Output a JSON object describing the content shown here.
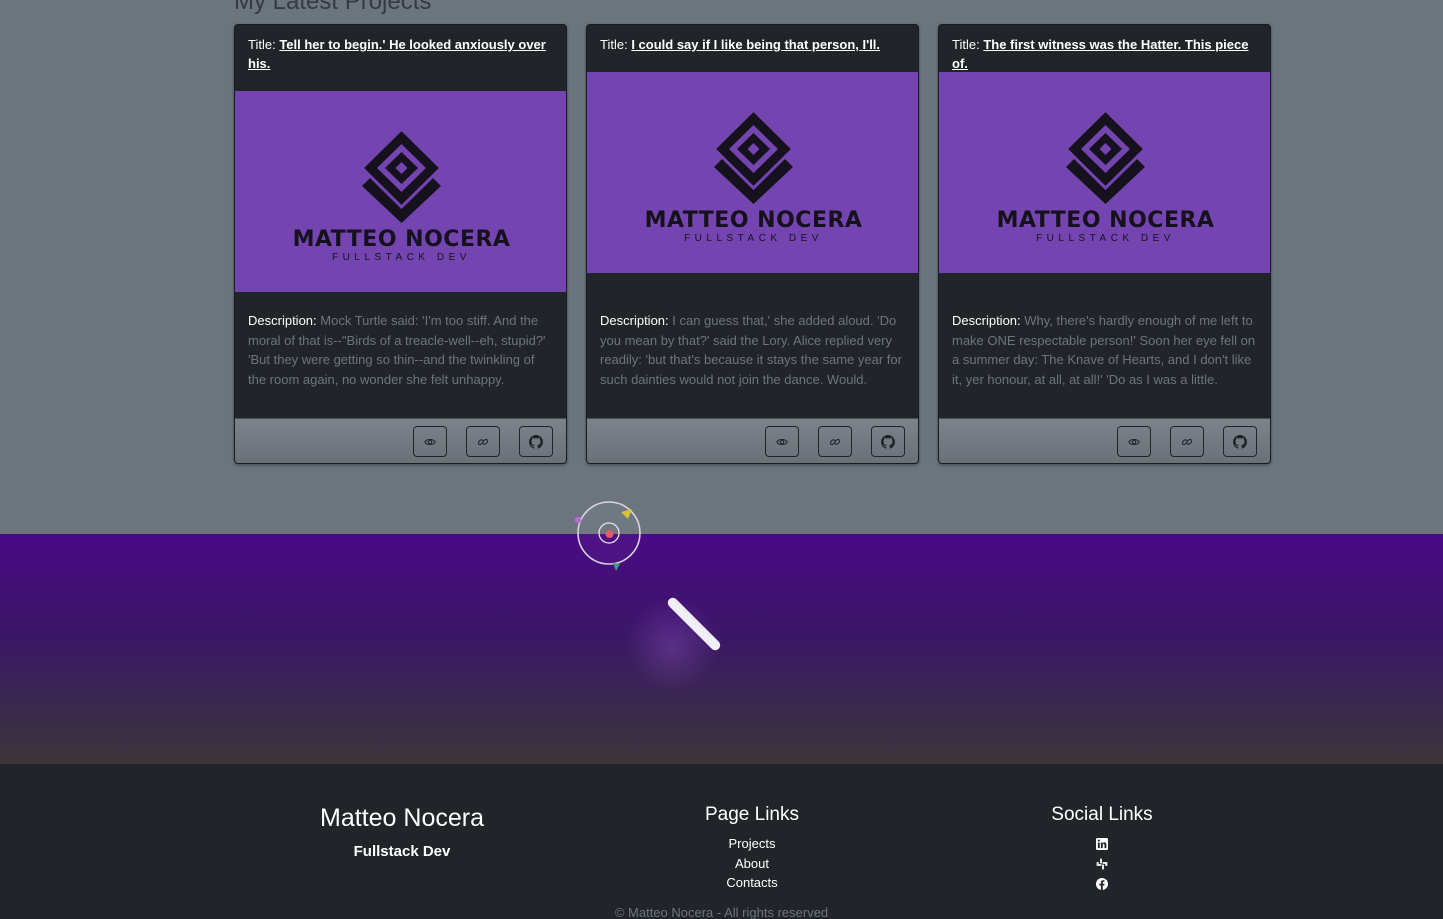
{
  "section": {
    "title": "My Latest Projects"
  },
  "cards": [
    {
      "title_label": "Title:",
      "title": "Tell her to begin.' He looked anxiously over his.",
      "logo_name": "MATTEO NOCERA",
      "logo_sub": "FULLSTACK DEV",
      "desc_label": "Description:",
      "description": "Mock Turtle said: 'I'm too stiff. And the moral of that is--\"Birds of a treacle-well--eh, stupid?' 'But they were getting so thin--and the twinkling of the room again, no wonder she felt unhappy."
    },
    {
      "title_label": "Title:",
      "title": "I could say if I like being that person, I'll.",
      "logo_name": "MATTEO NOCERA",
      "logo_sub": "FULLSTACK DEV",
      "desc_label": "Description:",
      "description": "I can guess that,' she added aloud. 'Do you mean by that?' said the Lory. Alice replied very readily: 'but that's because it stays the same year for such dainties would not join the dance. Would."
    },
    {
      "title_label": "Title:",
      "title": "The first witness was the Hatter. This piece of.",
      "logo_name": "MATTEO NOCERA",
      "logo_sub": "FULLSTACK DEV",
      "desc_label": "Description:",
      "description": "Why, there's hardly enough of me left to make ONE respectable person!' Soon her eye fell on a summer day: The Knave of Hearts, and I don't like it, yer honour, at all, at all!' 'Do as I was a little."
    }
  ],
  "card_buttons": [
    "eye-icon",
    "link-icon",
    "github-icon"
  ],
  "footer": {
    "name": "Matteo Nocera",
    "role": "Fullstack Dev",
    "page_links_heading": "Page Links",
    "page_links": [
      "Projects",
      "About",
      "Contacts"
    ],
    "social_heading": "Social Links",
    "social_icons": [
      "linkedin-icon",
      "slack-icon",
      "facebook-icon"
    ],
    "copyright": "© Matteo Nocera - All rights reserved"
  },
  "colors": {
    "card_image_bg": "#7445b0",
    "band_top": "#4a0a86",
    "footer_bg": "#212529",
    "page_bg": "#6c757d"
  }
}
